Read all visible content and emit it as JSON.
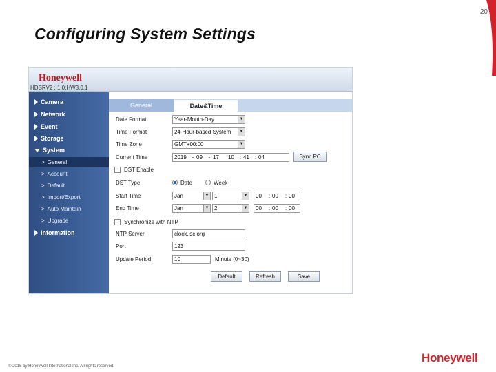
{
  "slide": {
    "number": "20",
    "title": "Configuring System Settings",
    "copyright": "© 2015 by Honeywell International Inc. All rights reserved.",
    "footer_logo": "Honeywell"
  },
  "screenshot": {
    "logo": "Honeywell",
    "version": "HDSRV2 : 1.0;HW3.0.1",
    "sidebar": {
      "camera": "Camera",
      "network": "Network",
      "event": "Event",
      "storage": "Storage",
      "system": "System",
      "sub_general": "General",
      "sub_account": "Account",
      "sub_default": "Default",
      "sub_import_export": "Import/Export",
      "sub_auto_maintain": "Auto Maintain",
      "sub_upgrade": "Upgrade",
      "information": "Information"
    },
    "tabs": {
      "general": "General",
      "datetime": "Date&Time"
    },
    "form": {
      "date_format_label": "Date Format",
      "date_format_value": "Year-Month-Day",
      "time_format_label": "Time Format",
      "time_format_value": "24-Hour-based System",
      "time_zone_label": "Time Zone",
      "time_zone_value": "GMT+00:00",
      "current_time_label": "Current Time",
      "current_year": "2019",
      "current_month": "09",
      "current_day": "17",
      "current_hour": "10",
      "current_min": "41",
      "current_sec": "04",
      "sync_pc": "Sync PC",
      "dst_enable": "DST Enable",
      "dst_type_label": "DST Type",
      "dst_type_date": "Date",
      "dst_type_week": "Week",
      "start_time_label": "Start Time",
      "start_month": "Jan",
      "start_day": "1",
      "start_hour": "00",
      "start_min": "00",
      "start_sec": "00",
      "end_time_label": "End Time",
      "end_month": "Jan",
      "end_day": "2",
      "end_hour": "00",
      "end_min": "00",
      "end_sec": "00",
      "sync_ntp": "Synchronize with NTP",
      "ntp_server_label": "NTP Server",
      "ntp_server_value": "clock.isc.org",
      "port_label": "Port",
      "port_value": "123",
      "update_period_label": "Update Period",
      "update_period_value": "10",
      "update_period_unit": "Minute (0~30)",
      "default_btn": "Default",
      "refresh_btn": "Refresh",
      "save_btn": "Save"
    }
  },
  "colors": {
    "brand_red": "#d2232a",
    "sidebar_blue": "#3a5c96"
  }
}
